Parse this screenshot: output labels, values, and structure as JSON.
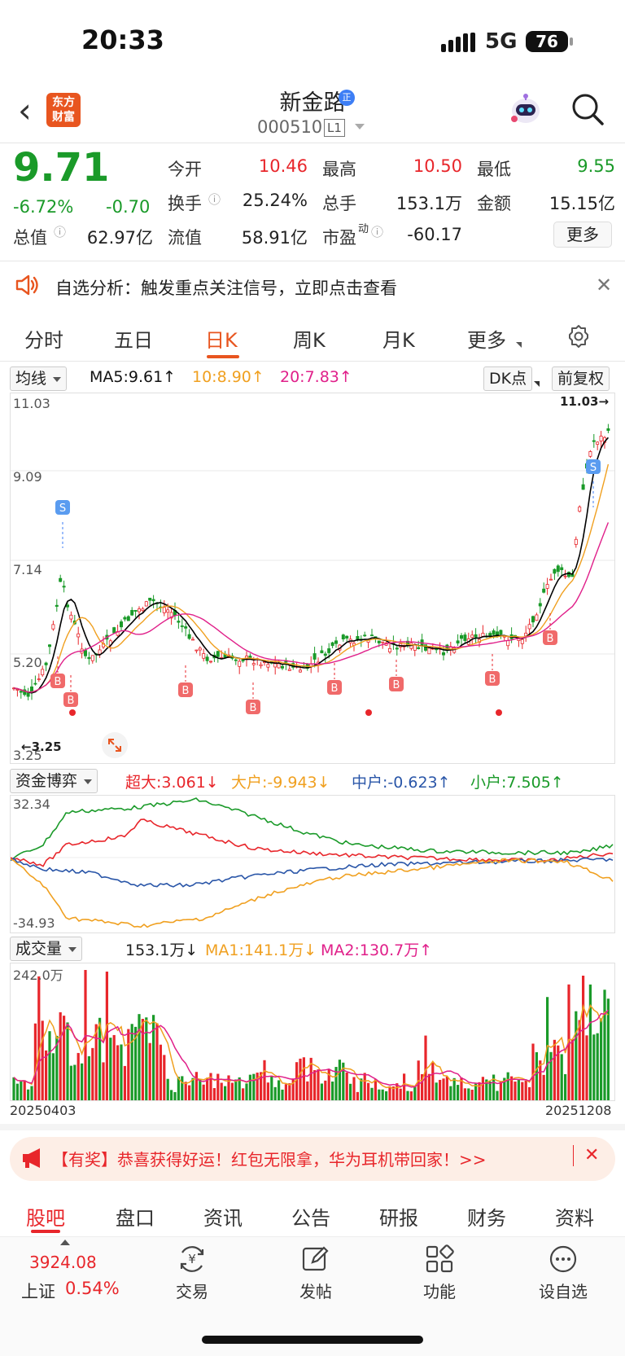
{
  "status": {
    "time": "20:33",
    "network": "5G",
    "battery": "76"
  },
  "header": {
    "logo_line1": "东方",
    "logo_line2": "财富",
    "name": "新金路",
    "badge": "正",
    "code": "000510",
    "level": "L1"
  },
  "quote": {
    "price": "9.71",
    "change_pct": "-6.72%",
    "change": "-0.70",
    "open_label": "今开",
    "open": "10.46",
    "high_label": "最高",
    "high": "10.50",
    "low_label": "最低",
    "low": "9.55",
    "turnover_label": "换手",
    "turnover": "25.24%",
    "volume_label": "总手",
    "volume": "153.1万",
    "amount_label": "金额",
    "amount": "15.15亿",
    "mcap_label": "总值",
    "mcap": "62.97亿",
    "float_label": "流值",
    "float": "58.91亿",
    "pe_label": "市盈",
    "pe_sup": "动",
    "pe": "-60.17",
    "more": "更多"
  },
  "notice": {
    "text": "自选分析：触发重点关注信号，立即点击查看"
  },
  "tabs": [
    "分时",
    "五日",
    "日K",
    "周K",
    "月K",
    "更多"
  ],
  "active_tab": "日K",
  "kline": {
    "indicator": "均线",
    "ma5": "MA5:9.61↑",
    "ma10": "10:8.90↑",
    "ma20": "20:7.83↑",
    "dk": "DK点",
    "adjust": "前复权",
    "y_labels": [
      "11.03",
      "9.09",
      "7.14",
      "5.20",
      "3.25"
    ],
    "max_marker": "11.03→",
    "min_marker": "←3.25",
    "signal_buy": "B",
    "signal_sell": "S"
  },
  "capital": {
    "indicator": "资金博弈",
    "super": "超大:3.061↓",
    "large": "大户:-9.943↓",
    "medium": "中户:-0.623↑",
    "small": "小户:7.505↑",
    "y_max": "32.34",
    "y_min": "-34.93"
  },
  "volume": {
    "indicator": "成交量",
    "value": "153.1万↓",
    "ma1": "MA1:141.1万↓",
    "ma2": "MA2:130.7万↑",
    "y_max": "242.0万",
    "start_date": "20250403",
    "end_date": "20251208"
  },
  "promo": {
    "text": "【有奖】恭喜获得好运！红包无限拿，华为耳机带回家！>>"
  },
  "bottom_tabs": [
    "股吧",
    "盘口",
    "资讯",
    "公告",
    "研报",
    "财务",
    "资料"
  ],
  "bottom_bar": {
    "index_value": "3924.08",
    "index_name": "上证",
    "index_change": "0.54%",
    "trade": "交易",
    "post": "发帖",
    "functions": "功能",
    "watchlist": "设自选"
  },
  "colors": {
    "up": "#e8262b",
    "down": "#1a9a29",
    "accent": "#e8551f",
    "ma5": "#000000",
    "ma10": "#f0a020",
    "ma20": "#e0208a"
  }
}
